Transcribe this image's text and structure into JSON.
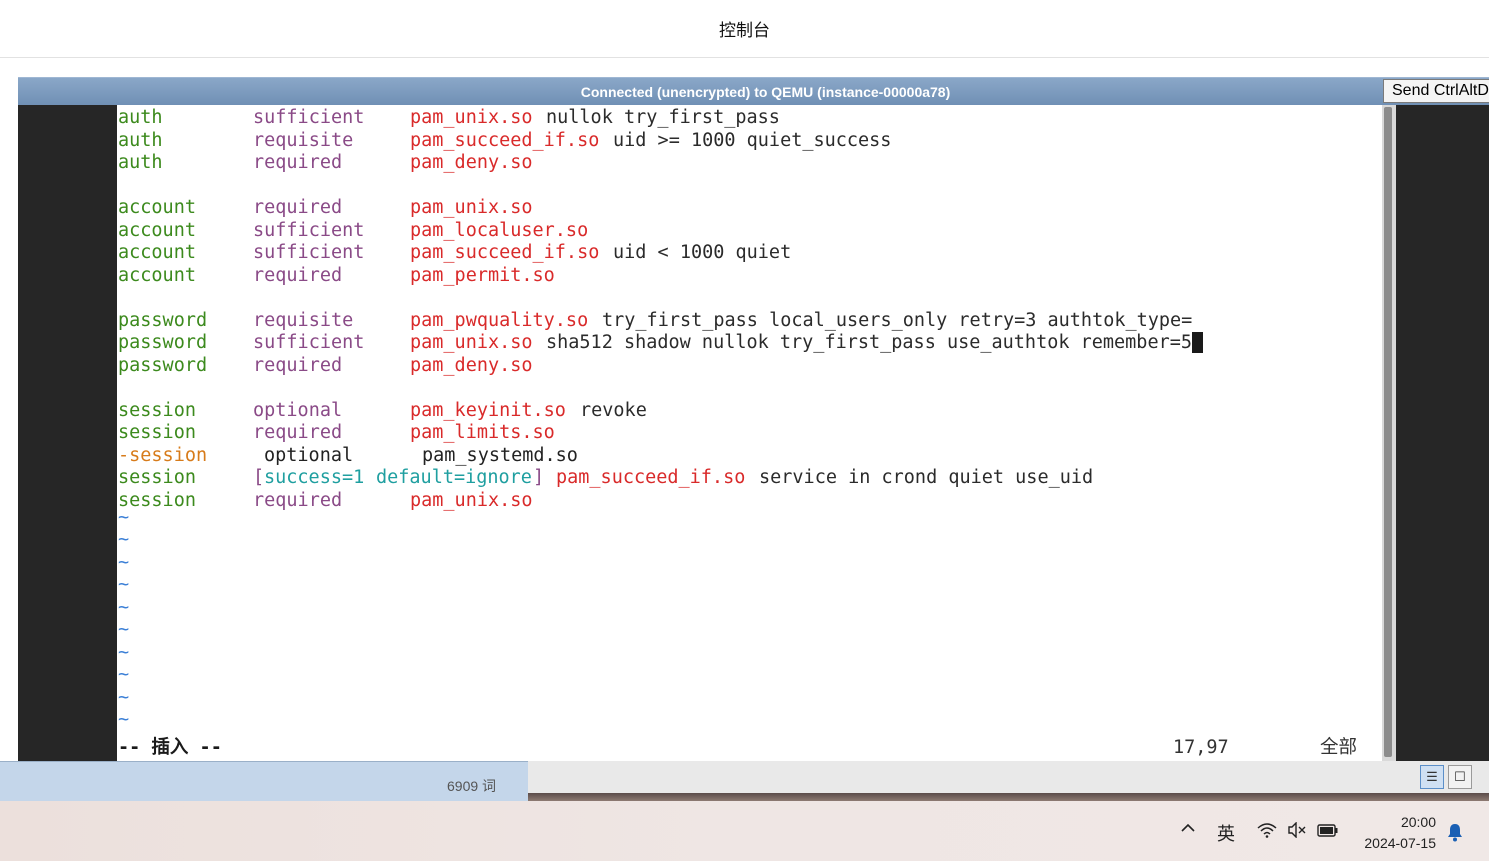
{
  "header": {
    "title": "控制台"
  },
  "vnc": {
    "status": "Connected (unencrypted) to QEMU (instance-00000a78)",
    "send_cad": "Send CtrlAltDel"
  },
  "editor": {
    "lines": [
      {
        "type": "auth",
        "ctrl": "sufficient",
        "module": "pam_unix.so",
        "args": "nullok try_first_pass"
      },
      {
        "type": "auth",
        "ctrl": "requisite",
        "module": "pam_succeed_if.so",
        "args": "uid >= 1000 quiet_success"
      },
      {
        "type": "auth",
        "ctrl": "required",
        "module": "pam_deny.so",
        "args": ""
      },
      {
        "type": "account",
        "ctrl": "required",
        "module": "pam_unix.so",
        "args": ""
      },
      {
        "type": "account",
        "ctrl": "sufficient",
        "module": "pam_localuser.so",
        "args": ""
      },
      {
        "type": "account",
        "ctrl": "sufficient",
        "module": "pam_succeed_if.so",
        "args": "uid < 1000 quiet"
      },
      {
        "type": "account",
        "ctrl": "required",
        "module": "pam_permit.so",
        "args": ""
      },
      {
        "type": "password",
        "ctrl": "requisite",
        "module": "pam_pwquality.so",
        "args": "try_first_pass local_users_only retry=3 authtok_type="
      },
      {
        "type": "password",
        "ctrl": "sufficient",
        "module": "pam_unix.so",
        "args": "sha512 shadow nullok try_first_pass use_authtok remember=5"
      },
      {
        "type": "password",
        "ctrl": "required",
        "module": "pam_deny.so",
        "args": ""
      },
      {
        "type": "session",
        "ctrl": "optional",
        "module": "pam_keyinit.so",
        "args": "revoke"
      },
      {
        "type": "session",
        "ctrl": "required",
        "module": "pam_limits.so",
        "args": ""
      },
      {
        "type": "-session",
        "ctrl": "optional",
        "module": "pam_systemd.so",
        "args": ""
      },
      {
        "type": "session",
        "ctrl_open": "[",
        "ctrl_a": "success=1",
        "ctrl_b": "default=ignore",
        "ctrl_close": "]",
        "module": "pam_succeed_if.so",
        "args": "service in crond quiet use_uid"
      },
      {
        "type": "session",
        "ctrl": "required",
        "module": "pam_unix.so",
        "args": ""
      }
    ],
    "tilde": "~",
    "mode": "-- 插入 --",
    "cursor_pos": "17,97",
    "scroll_pos": "全部"
  },
  "word": {
    "count": "6909 词"
  },
  "taskbar": {
    "ime": "英",
    "time": "20:00",
    "date": "2024-07-15"
  },
  "colors": {
    "keyword": "#3c8a1d",
    "control": "#8a4a87",
    "module": "#d92a2a",
    "tilde": "#3b7fd6",
    "vnc_bar": "#7896bb"
  }
}
